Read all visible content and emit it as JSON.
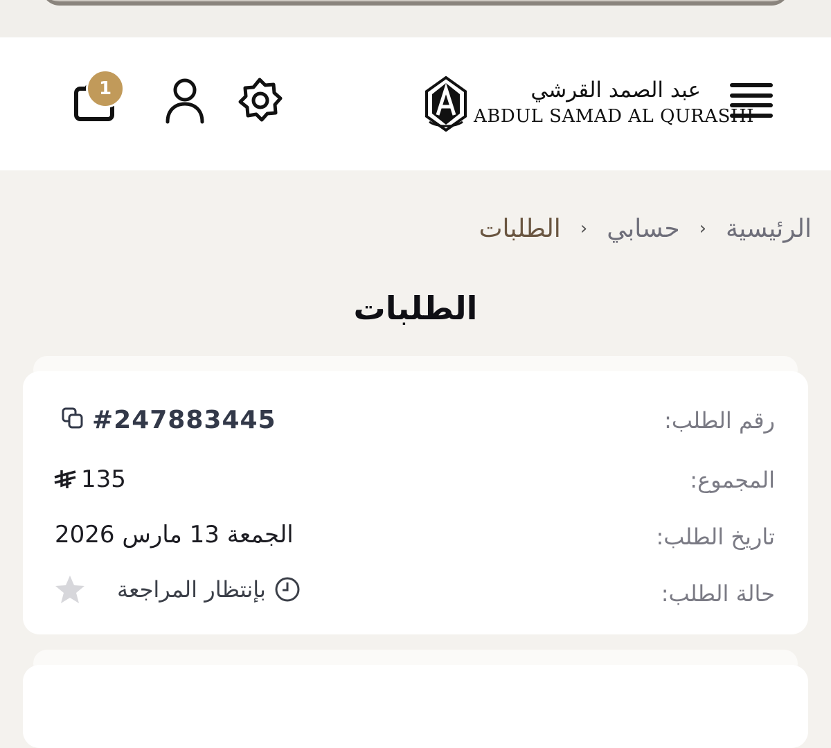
{
  "header": {
    "logo_ar": "عبد الصمد القرشي",
    "logo_en": "ABDUL SAMAD AL QURASHI",
    "cart_count": "1"
  },
  "breadcrumb": {
    "home": "الرئيسية",
    "account": "حسابي",
    "current": "الطلبات",
    "separator": "›"
  },
  "page": {
    "title": "الطلبات"
  },
  "order": {
    "number_label": "رقم الطلب:",
    "number": "#247883445",
    "total_label": "المجموع:",
    "total": "135",
    "date_label": "تاريخ الطلب:",
    "date": "الجمعة 13 مارس 2026",
    "status_label": "حالة الطلب:",
    "status": "بإنتظار المراجعة"
  },
  "colors": {
    "accent": "#c19a5a",
    "breadcrumb_current": "#6a5641",
    "page_bg": "#f4f2ee"
  }
}
